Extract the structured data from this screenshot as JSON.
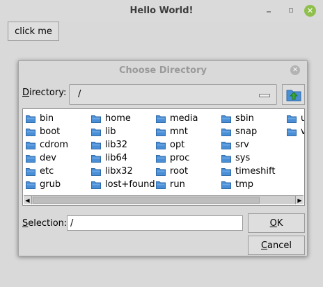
{
  "window": {
    "title": "Hello World!"
  },
  "main": {
    "click_me_label": "click me"
  },
  "dialog": {
    "title": "Choose Directory",
    "directory_label_mnemonic": "D",
    "directory_label_rest": "irectory:",
    "directory_value": "/",
    "folders_col1": [
      "bin",
      "boot",
      "cdrom",
      "dev",
      "etc",
      "grub"
    ],
    "folders_col2": [
      "home",
      "lib",
      "lib32",
      "lib64",
      "libx32",
      "lost+found"
    ],
    "folders_col3": [
      "media",
      "mnt",
      "opt",
      "proc",
      "root",
      "run"
    ],
    "folders_col4": [
      "sbin",
      "snap",
      "srv",
      "sys",
      "timeshift",
      "tmp"
    ],
    "folders_col5": [
      "u",
      "v"
    ],
    "selection_label_mnemonic": "S",
    "selection_label_rest": "election:",
    "selection_value": "/",
    "ok_mnemonic": "O",
    "ok_rest": "K",
    "cancel_mnemonic": "C",
    "cancel_rest": "ancel",
    "folder_color": "#4a8fd6",
    "folder_tab_color": "#6aa6e4",
    "up_arrow_color": "#3aa53a"
  }
}
